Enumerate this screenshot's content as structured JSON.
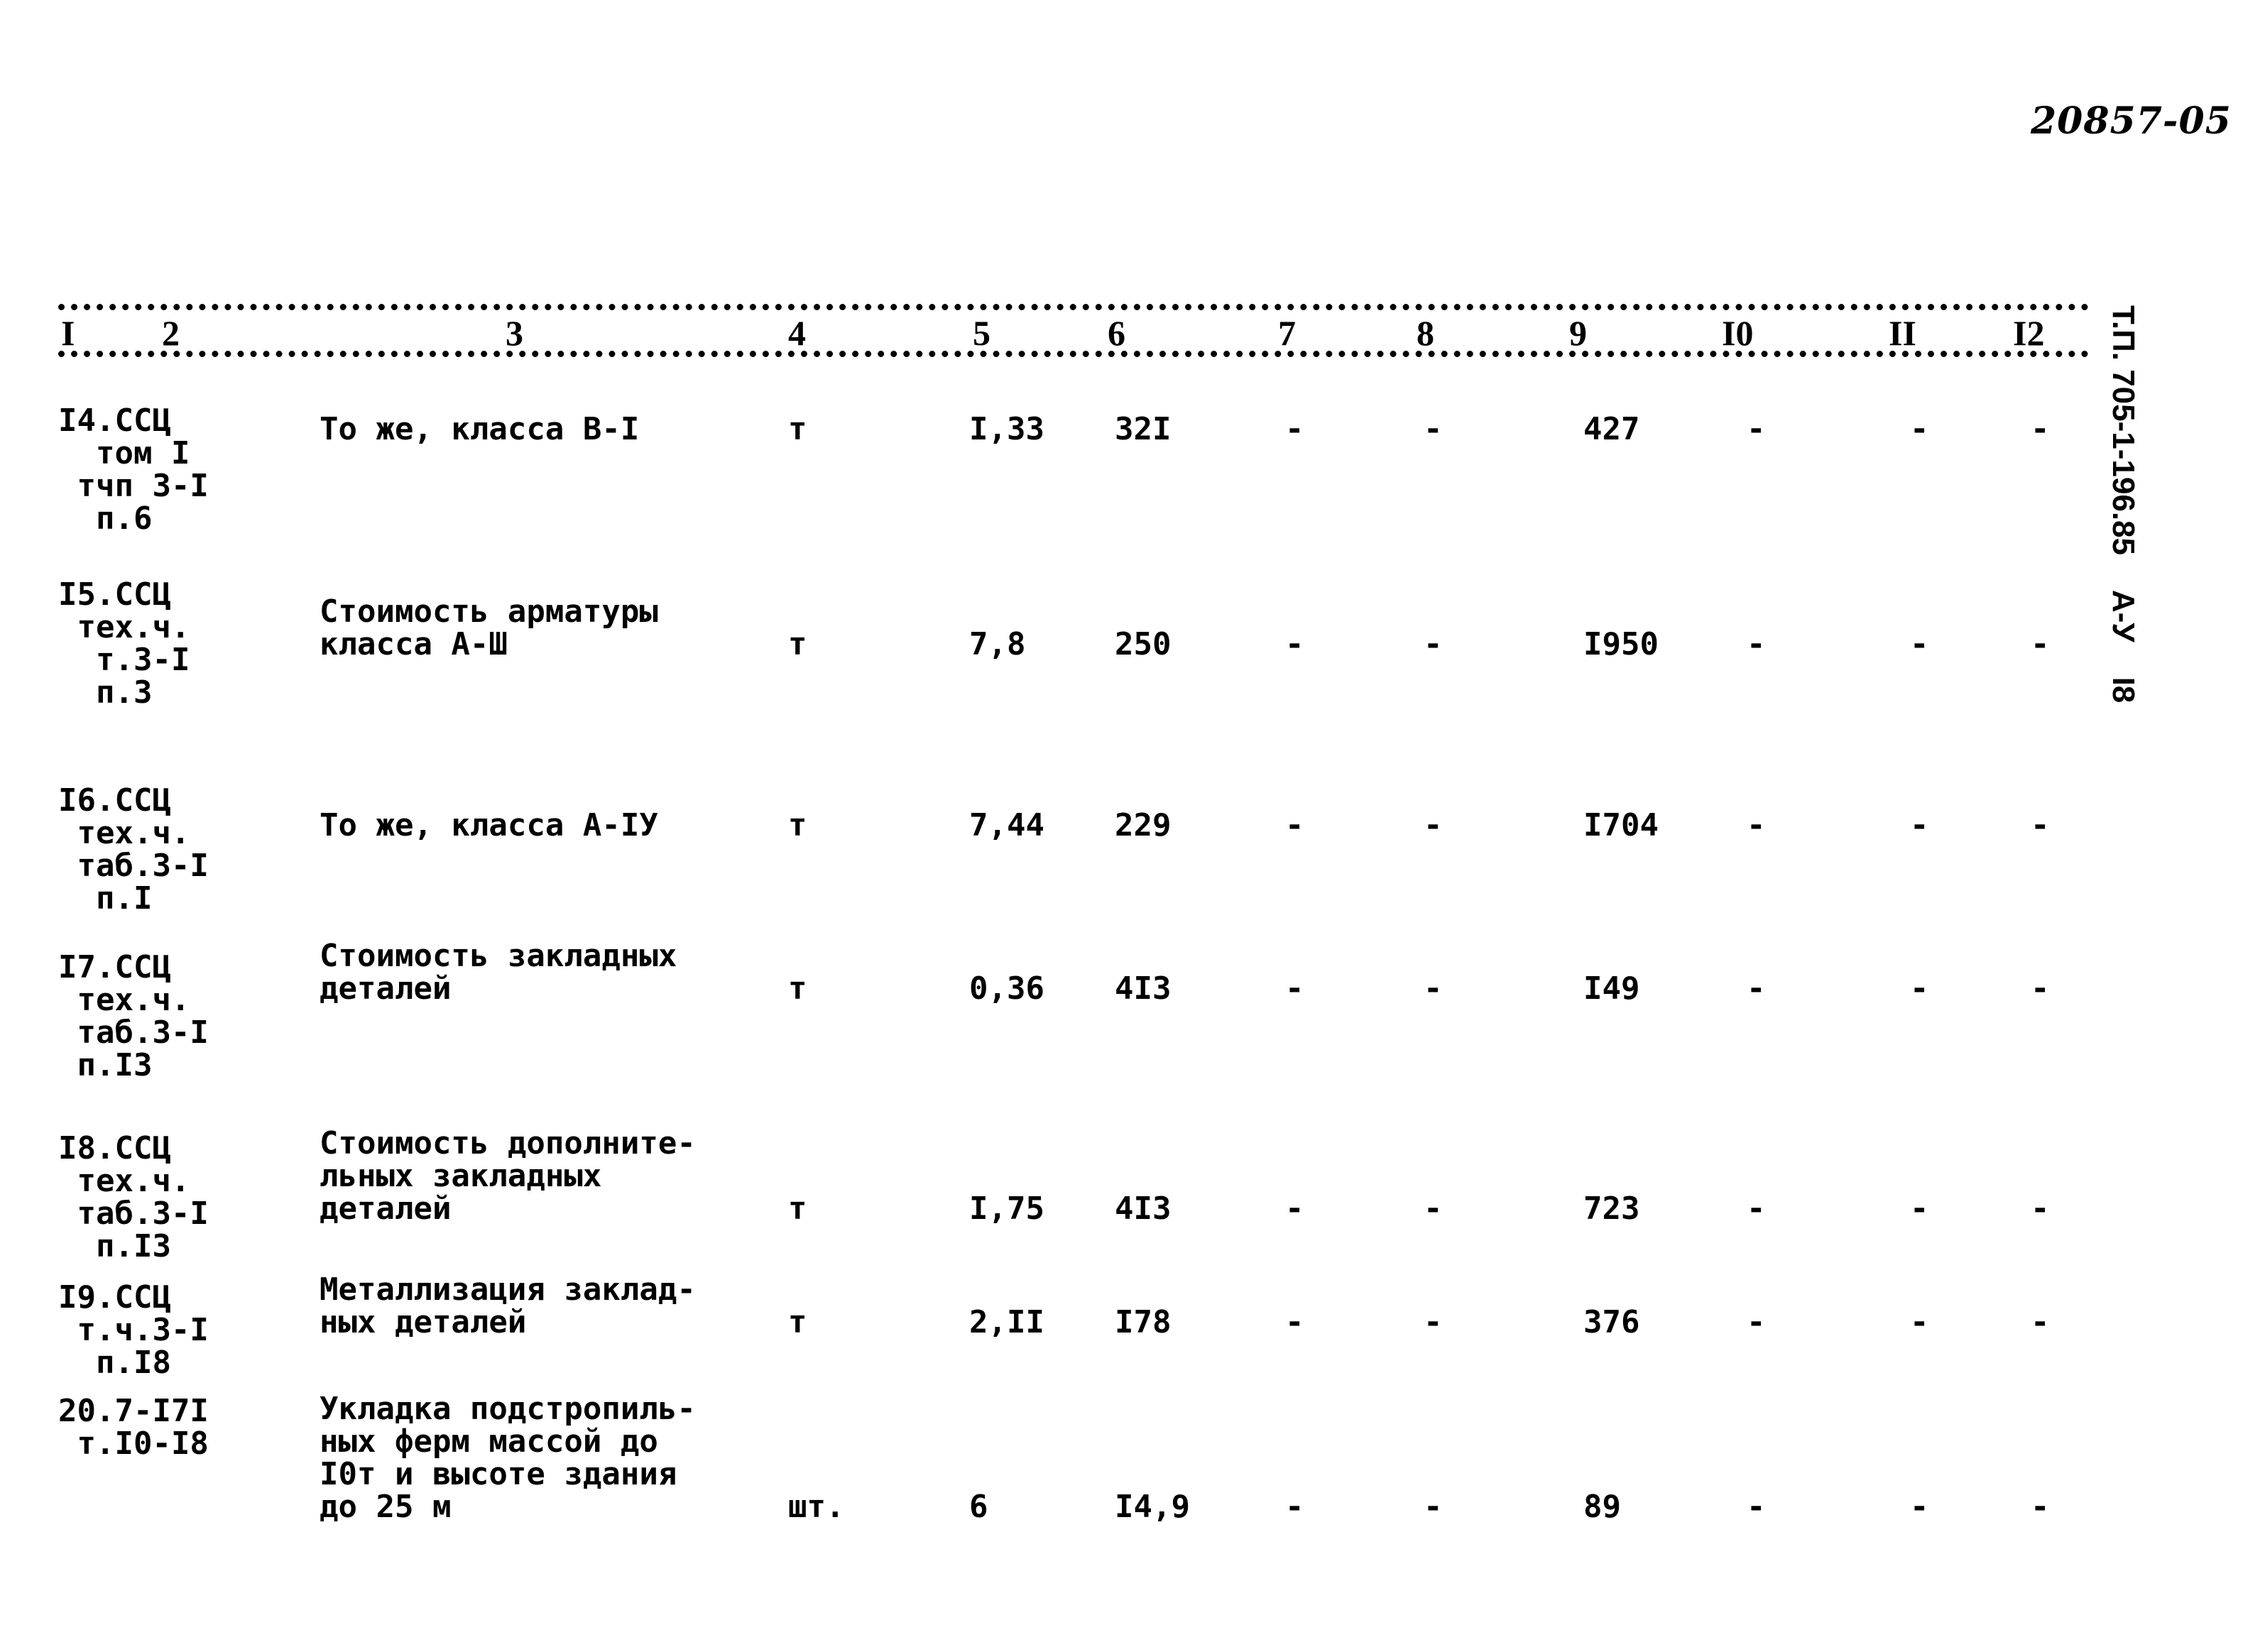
{
  "document_number": "20857-05",
  "side_stamp": "Т.П. 705-1-196.85    А-У    I8",
  "columns": [
    "I",
    "2",
    "3",
    "4",
    "5",
    "6",
    "7",
    "8",
    "9",
    "I0",
    "II",
    "I2"
  ],
  "rows": [
    {
      "ref": [
        "I4.ССЦ",
        "  том I",
        " тчп 3-I",
        "  п.6"
      ],
      "description": [
        "То же, класса В-I"
      ],
      "unit": "т",
      "qty": "I,33",
      "price": "32I",
      "c7": "-",
      "c8": "-",
      "total": "427",
      "c10": "-",
      "c11": "-",
      "c12": "-"
    },
    {
      "ref": [
        "I5.ССЦ",
        " тех.ч.",
        "  т.3-I",
        "  п.3"
      ],
      "description": [
        "Стоимость арматуры",
        "класса А-Ш"
      ],
      "unit": "т",
      "qty": "7,8",
      "price": "250",
      "c7": "-",
      "c8": "-",
      "total": "I950",
      "c10": "-",
      "c11": "-",
      "c12": "-"
    },
    {
      "ref": [
        "I6.ССЦ",
        " тех.ч.",
        " таб.3-I",
        "  п.I"
      ],
      "description": [
        "То же, класса А-IУ"
      ],
      "unit": "т",
      "qty": "7,44",
      "price": "229",
      "c7": "-",
      "c8": "-",
      "total": "I704",
      "c10": "-",
      "c11": "-",
      "c12": "-"
    },
    {
      "ref": [
        "I7.ССЦ",
        " тех.ч.",
        " таб.3-I",
        " п.I3"
      ],
      "description": [
        "Стоимость закладных",
        "деталей"
      ],
      "unit": "т",
      "qty": "0,36",
      "price": "4I3",
      "c7": "-",
      "c8": "-",
      "total": "I49",
      "c10": "-",
      "c11": "-",
      "c12": "-"
    },
    {
      "ref": [
        "I8.ССЦ",
        " тех.ч.",
        " таб.3-I",
        "  п.I3"
      ],
      "description": [
        "Стоимость дополните-",
        "льных закладных",
        "деталей"
      ],
      "unit": "т",
      "qty": "I,75",
      "price": "4I3",
      "c7": "-",
      "c8": "-",
      "total": "723",
      "c10": "-",
      "c11": "-",
      "c12": "-"
    },
    {
      "ref": [
        "I9.ССЦ",
        " т.ч.3-I",
        "  п.I8"
      ],
      "description": [
        "Металлизация заклад-",
        "ных деталей"
      ],
      "unit": "т",
      "qty": "2,II",
      "price": "I78",
      "c7": "-",
      "c8": "-",
      "total": "376",
      "c10": "-",
      "c11": "-",
      "c12": "-"
    },
    {
      "ref": [
        "20.7-I7I",
        " т.I0-I8"
      ],
      "description": [
        "Укладка подстропиль-",
        "ных ферм массой до",
        "I0т и высоте здания",
        "до 25 м"
      ],
      "unit": "шт.",
      "qty": "6",
      "price": "I4,9",
      "c7": "-",
      "c8": "-",
      "total": "89",
      "c10": "-",
      "c11": "-",
      "c12": "-"
    }
  ]
}
